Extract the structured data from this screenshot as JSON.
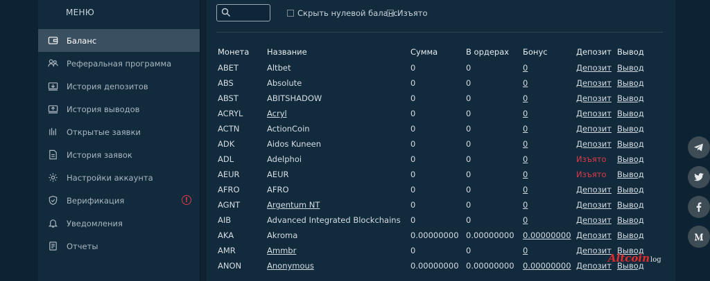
{
  "sidebar": {
    "title": "МЕНЮ",
    "items": [
      {
        "label": "Баланс",
        "icon": "wallet-icon",
        "active": true
      },
      {
        "label": "Реферальная программа",
        "icon": "referral-icon"
      },
      {
        "label": "История депозитов",
        "icon": "deposit-history-icon"
      },
      {
        "label": "История выводов",
        "icon": "withdraw-history-icon"
      },
      {
        "label": "Открытые заявки",
        "icon": "open-orders-icon"
      },
      {
        "label": "История заявок",
        "icon": "orders-history-icon"
      },
      {
        "label": "Настройки аккаунта",
        "icon": "gear-icon"
      },
      {
        "label": "Верификация",
        "icon": "shield-icon",
        "badge": "!"
      },
      {
        "label": "Уведомления",
        "icon": "bell-icon"
      },
      {
        "label": "Отчеты",
        "icon": "report-icon"
      }
    ]
  },
  "toolbar": {
    "search": {
      "placeholder": "",
      "value": ""
    },
    "hide_zero_label": "Скрыть нулевой баланс",
    "delisted_label": "Изъято"
  },
  "table": {
    "headers": {
      "coin": "Монета",
      "name": "Название",
      "sum": "Сумма",
      "orders": "В ордерах",
      "bonus": "Бонус",
      "deposit": "Депозит",
      "withdraw": "Вывод"
    },
    "rows": [
      {
        "coin": "ABET",
        "name": "Altbet",
        "sum": "0",
        "orders": "0",
        "bonus": "0",
        "deposit": "Депозит",
        "withdraw": "Вывод"
      },
      {
        "coin": "ABS",
        "name": "Absolute",
        "sum": "0",
        "orders": "0",
        "bonus": "0",
        "deposit": "Депозит",
        "withdraw": "Вывод"
      },
      {
        "coin": "ABST",
        "name": "ABITSHADOW",
        "sum": "0",
        "orders": "0",
        "bonus": "0",
        "deposit": "Депозит",
        "withdraw": "Вывод"
      },
      {
        "coin": "ACRYL",
        "name": "Acryl",
        "sum": "0",
        "orders": "0",
        "bonus": "0",
        "deposit": "Депозит",
        "withdraw": "Вывод",
        "name_link": true
      },
      {
        "coin": "ACTN",
        "name": "ActionCoin",
        "sum": "0",
        "orders": "0",
        "bonus": "0",
        "deposit": "Депозит",
        "withdraw": "Вывод"
      },
      {
        "coin": "ADK",
        "name": "Aidos Kuneen",
        "sum": "0",
        "orders": "0",
        "bonus": "0",
        "deposit": "Депозит",
        "withdraw": "Вывод"
      },
      {
        "coin": "ADL",
        "name": "Adelphoi",
        "sum": "0",
        "orders": "0",
        "bonus": "0",
        "deposit": "Изъято",
        "withdraw": "Вывод",
        "delisted": true
      },
      {
        "coin": "AEUR",
        "name": "AEUR",
        "sum": "0",
        "orders": "0",
        "bonus": "0",
        "deposit": "Изъято",
        "withdraw": "Вывод",
        "delisted": true
      },
      {
        "coin": "AFRO",
        "name": "AFRO",
        "sum": "0",
        "orders": "0",
        "bonus": "0",
        "deposit": "Депозит",
        "withdraw": "Вывод"
      },
      {
        "coin": "AGNT",
        "name": "Argentum NT",
        "sum": "0",
        "orders": "0",
        "bonus": "0",
        "deposit": "Депозит",
        "withdraw": "Вывод",
        "name_link": true
      },
      {
        "coin": "AIB",
        "name": "Advanced Integrated Blockchains",
        "sum": "0",
        "orders": "0",
        "bonus": "0",
        "deposit": "Депозит",
        "withdraw": "Вывод"
      },
      {
        "coin": "AKA",
        "name": "Akroma",
        "sum": "0.00000000",
        "orders": "0.00000000",
        "bonus": "0.00000000",
        "deposit": "Депозит",
        "withdraw": "Вывод"
      },
      {
        "coin": "AMR",
        "name": "Ammbr",
        "sum": "0",
        "orders": "0",
        "bonus": "0",
        "deposit": "Депозит",
        "withdraw": "Вывод",
        "name_link": true
      },
      {
        "coin": "ANON",
        "name": "Anonymous",
        "sum": "0.00000000",
        "orders": "0.00000000",
        "bonus": "0.00000000",
        "deposit": "Депозит",
        "withdraw": "Вывод",
        "name_link": true
      }
    ]
  },
  "social": [
    "telegram-icon",
    "twitter-icon",
    "facebook-icon",
    "medium-icon"
  ],
  "watermark": {
    "brand": "Altcoin",
    "suffix": "log"
  },
  "colors": {
    "accent_red": "#e0394a",
    "active_item": "#3a4f60",
    "panel": "#112a3c"
  }
}
